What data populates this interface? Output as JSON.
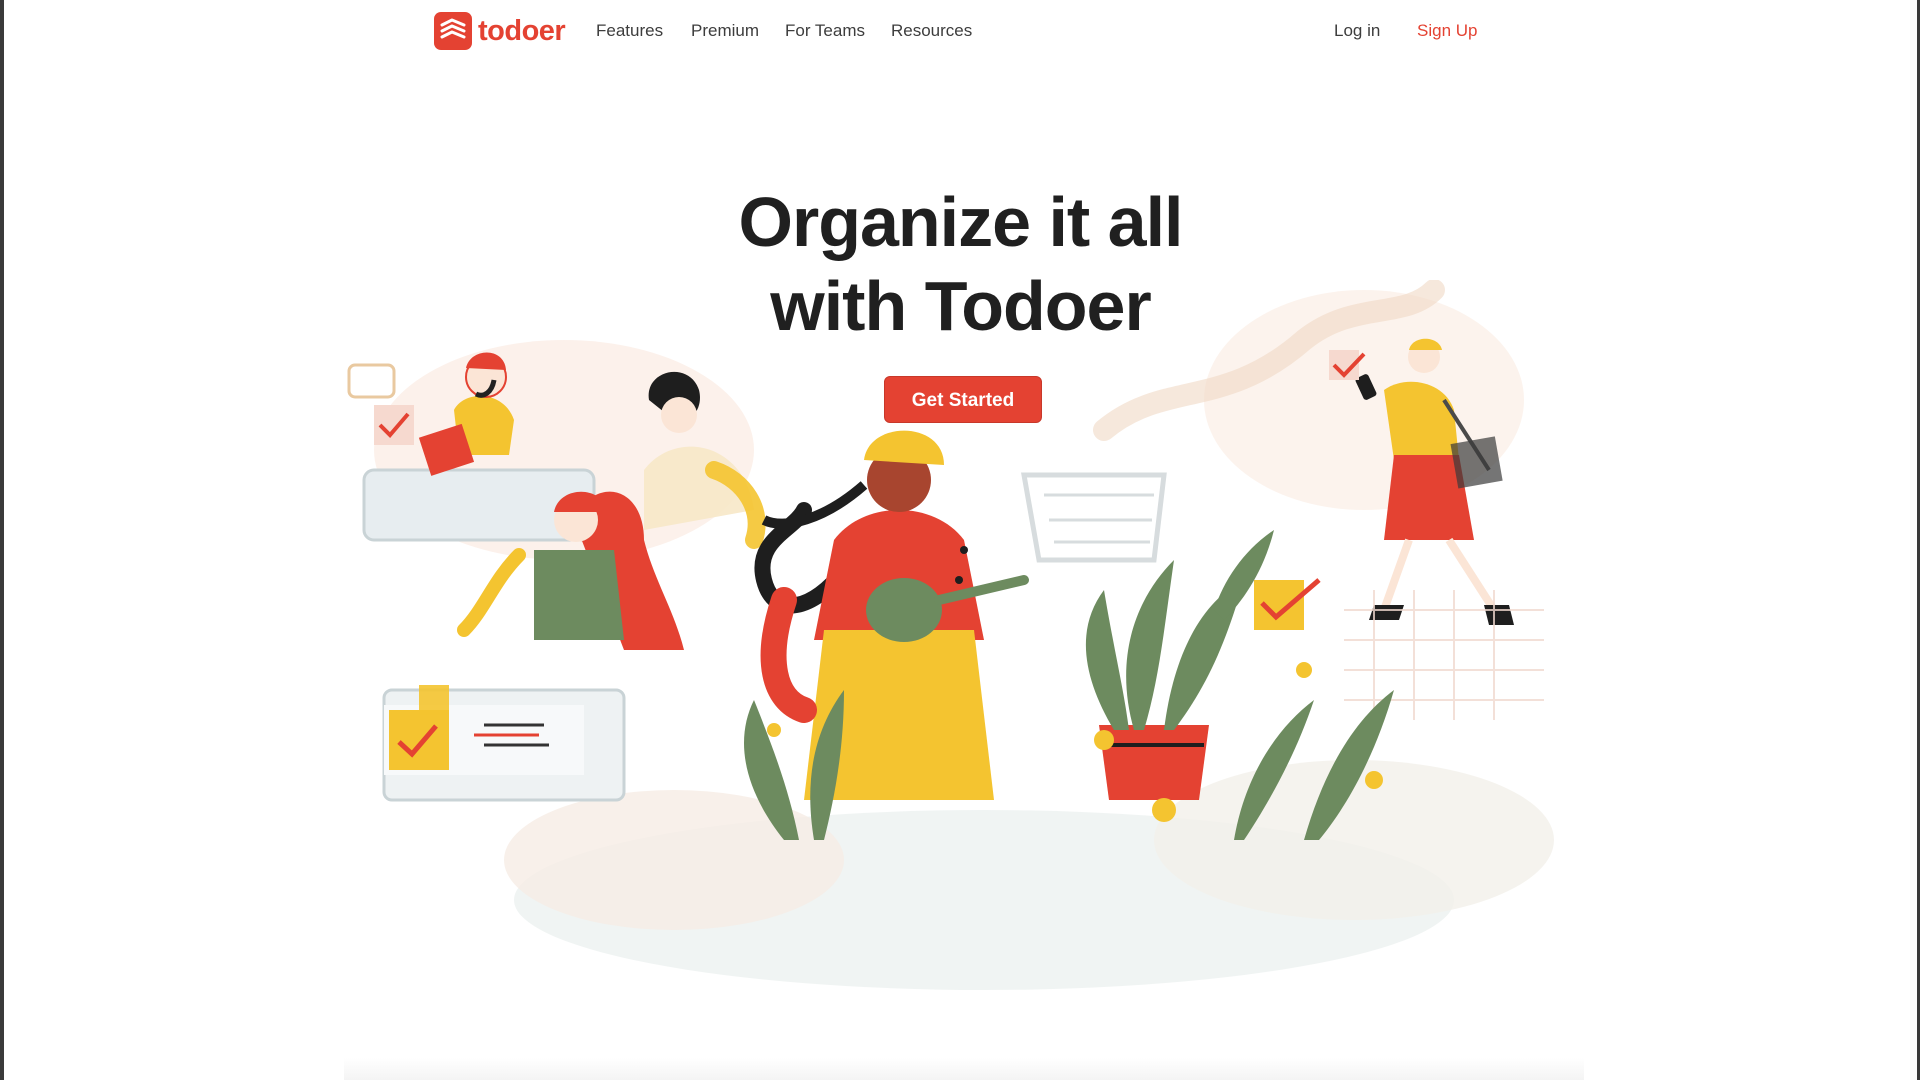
{
  "nav": {
    "logo_text": "todoer",
    "links": [
      "Features",
      "Premium",
      "For Teams",
      "Resources"
    ],
    "login": "Log in",
    "signup": "Sign Up"
  },
  "hero": {
    "title_line1": "Organize it all",
    "title_line2": "with Todoer",
    "cta": "Get Started"
  },
  "illustration": {
    "icon": "people-organizing-illustration"
  },
  "colors": {
    "brand": "#e44232",
    "text_dark": "#202020",
    "nav_text": "#3d3d3d",
    "illustration_yellow": "#f4c430",
    "illustration_green": "#6d8b5f",
    "illustration_red": "#e44232"
  }
}
